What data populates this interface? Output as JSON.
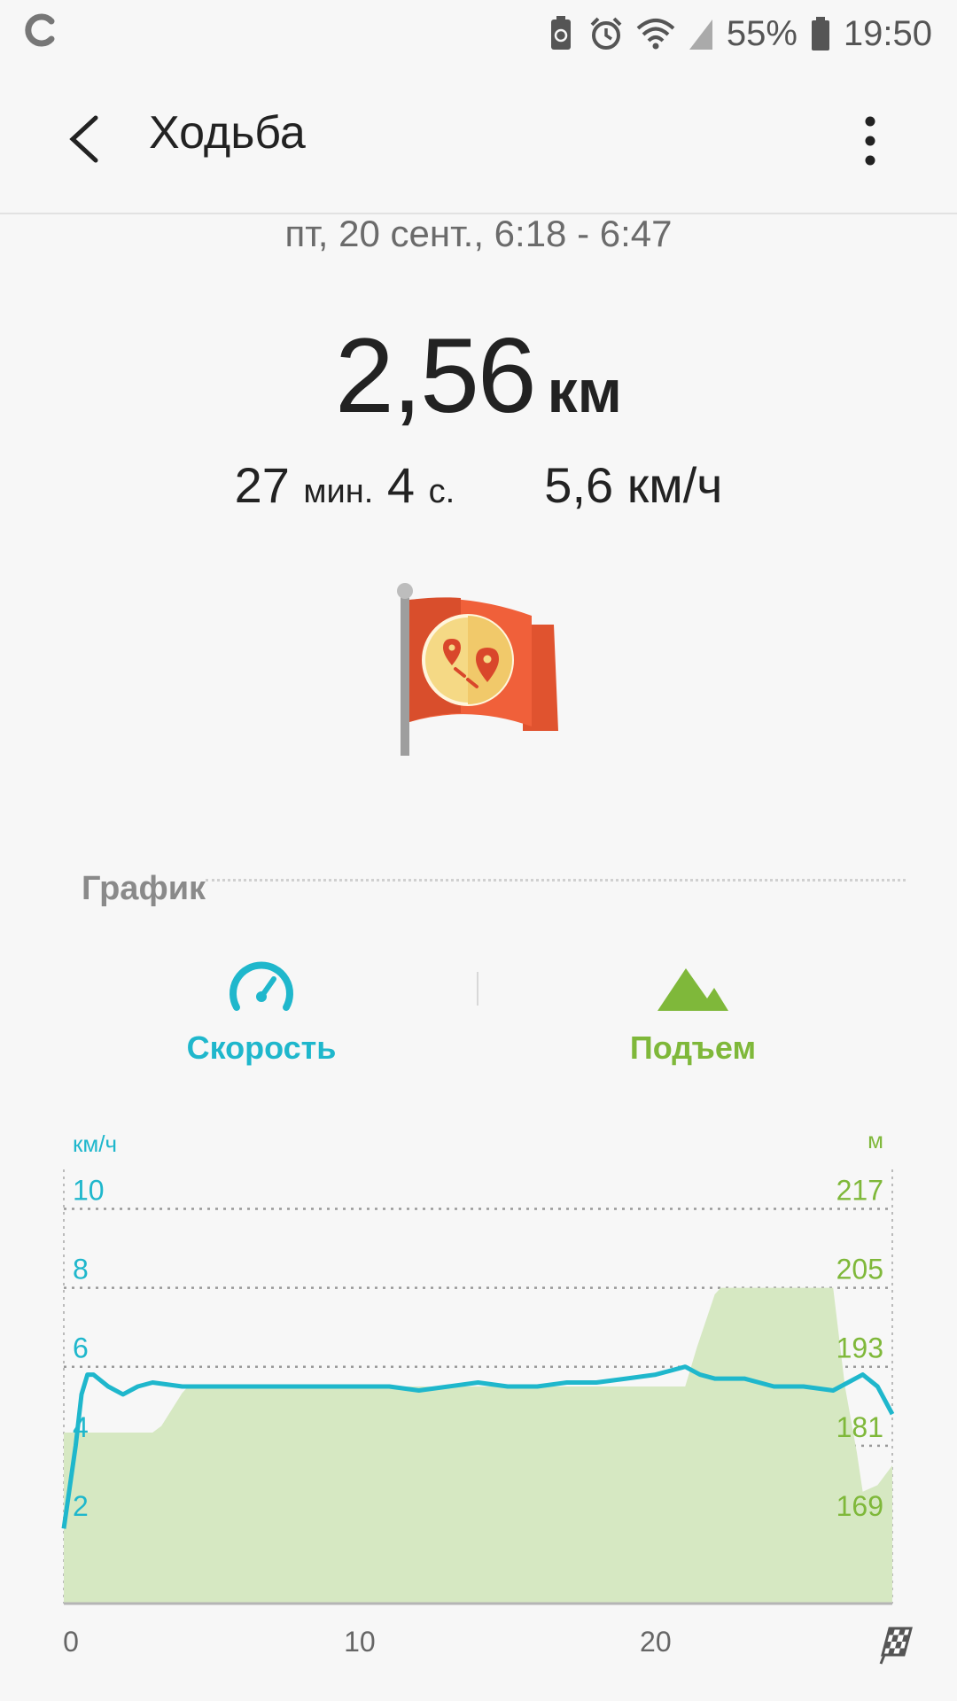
{
  "status_bar": {
    "battery_percent": "55%",
    "time": "19:50",
    "icons": [
      "sync-icon",
      "battery-saver-icon",
      "alarm-icon",
      "wifi-icon",
      "signal-icon",
      "battery-icon"
    ]
  },
  "header": {
    "title": "Ходьба",
    "back_icon": "back-arrow-icon",
    "menu_icon": "more-vert-icon"
  },
  "summary": {
    "datetime": "пт, 20 сент., 6:18 - 6:47",
    "distance_value": "2,56",
    "distance_unit": "км",
    "duration_min": "27",
    "duration_min_unit": "мин.",
    "duration_sec": "4",
    "duration_sec_unit": "с.",
    "speed": "5,6 км/ч",
    "badge_icon": "route-flag-icon"
  },
  "graph": {
    "section_label": "График",
    "tabs": [
      {
        "label": "Скорость",
        "icon": "speedometer-icon",
        "color": "#1fb7cc"
      },
      {
        "label": "Подъем",
        "icon": "mountain-icon",
        "color": "#7fb83a"
      }
    ]
  },
  "chart_data": {
    "type": "line",
    "left_unit": "км/ч",
    "right_unit": "м",
    "left_ticks": [
      "10",
      "8",
      "6",
      "4",
      "2"
    ],
    "right_ticks": [
      "217",
      "205",
      "193",
      "181",
      "169"
    ],
    "x_ticks": [
      "0",
      "10",
      "20"
    ],
    "x_finish_icon": "finish-flag-icon",
    "xlim": [
      0,
      28
    ],
    "ylim_left": [
      0,
      11
    ],
    "ylim_right": [
      157,
      223
    ],
    "grid": true,
    "speed_color": "#1fb7cc",
    "elevation_color": "#d6e8c2",
    "series": [
      {
        "name": "Скорость",
        "axis": "left",
        "x": [
          0,
          0.4,
          0.6,
          0.8,
          1.0,
          1.5,
          2.0,
          2.5,
          3.0,
          4.0,
          5.0,
          6.0,
          7.0,
          8.0,
          9.0,
          10.0,
          11.0,
          12.0,
          13.0,
          14.0,
          15.0,
          16.0,
          17.0,
          18.0,
          19.0,
          20.0,
          21.0,
          21.5,
          22.0,
          23.0,
          24.0,
          25.0,
          26.0,
          27.0,
          27.5,
          28.0
        ],
        "y": [
          1.9,
          4.0,
          5.3,
          5.8,
          5.8,
          5.5,
          5.3,
          5.5,
          5.6,
          5.5,
          5.5,
          5.5,
          5.5,
          5.5,
          5.5,
          5.5,
          5.5,
          5.4,
          5.5,
          5.6,
          5.5,
          5.5,
          5.6,
          5.6,
          5.7,
          5.8,
          6.0,
          5.8,
          5.7,
          5.7,
          5.5,
          5.5,
          5.4,
          5.8,
          5.5,
          4.8
        ]
      },
      {
        "name": "Подъем",
        "axis": "right",
        "x": [
          0,
          3.0,
          3.3,
          4.0,
          4.2,
          21.0,
          21.4,
          22.0,
          22.2,
          26.0,
          26.4,
          26.8,
          27.0,
          27.5,
          28.0
        ],
        "y": [
          183,
          183,
          184,
          189,
          190,
          190,
          196,
          204,
          205,
          205,
          190,
          180,
          174,
          175,
          178
        ]
      }
    ]
  }
}
